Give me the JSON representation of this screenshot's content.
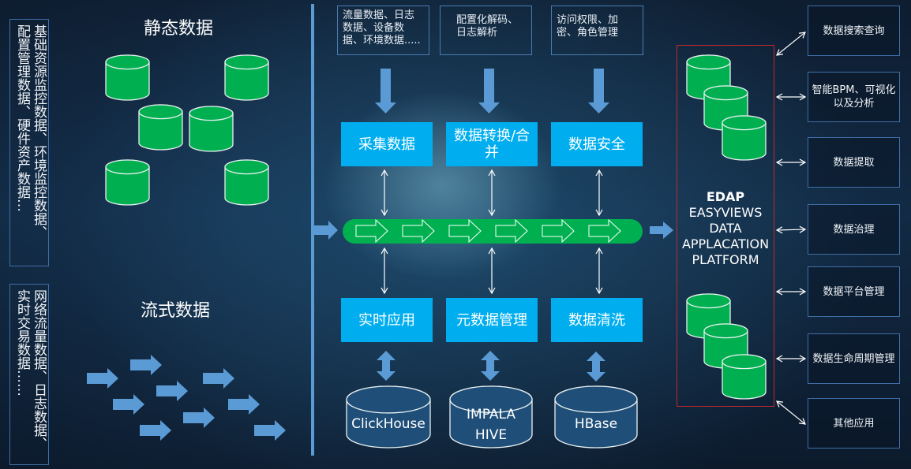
{
  "static_section": {
    "title": "静态数据",
    "description_col1": "基础资源监控数据、环境监控数据、",
    "description_col2": "配置管理数据、硬件资产数据…",
    "db_icon_count": 6
  },
  "stream_section": {
    "title": "流式数据",
    "description_col1": "网络流量数据、日志数据、",
    "description_col2": "实时交易数据……",
    "arrow_icon_count": 9
  },
  "sources": [
    {
      "text": "流量数据、日志数据、设备数据、环境数据....."
    },
    {
      "text": "配置化解码、日志解析"
    },
    {
      "text": "访问权限、加密、角色管理"
    }
  ],
  "processes_top": [
    {
      "label": "采集数据"
    },
    {
      "label": "数据转换/合并"
    },
    {
      "label": "数据安全"
    }
  ],
  "processes_bottom": [
    {
      "label": "实时应用"
    },
    {
      "label": "元数据管理"
    },
    {
      "label": "数据清洗"
    }
  ],
  "pipeline": {
    "arrow_count": 6
  },
  "storage": [
    {
      "line1": "ClickHouse",
      "line2": ""
    },
    {
      "line1": "IMPALA",
      "line2": "HIVE"
    },
    {
      "line1": "HBase",
      "line2": ""
    }
  ],
  "platform": {
    "acronym": "EDAP",
    "line1": "EASYVIEWS",
    "line2": "DATA",
    "line3": "APPLACATION",
    "line4": "PLATFORM"
  },
  "applications": [
    {
      "label": "数据搜索查询"
    },
    {
      "label": "智能BPM、可视化以及分析"
    },
    {
      "label": "数据提取"
    },
    {
      "label": "数据治理"
    },
    {
      "label": "数据平台管理"
    },
    {
      "label": "数据生命周期管理"
    },
    {
      "label": "其他应用"
    }
  ],
  "colors": {
    "db_green": "#00b050",
    "process_blue": "#00aeef",
    "arrow_blue": "#5b9bd5",
    "edap_border": "#c0282d",
    "storage_fill": "#1f4e79"
  }
}
